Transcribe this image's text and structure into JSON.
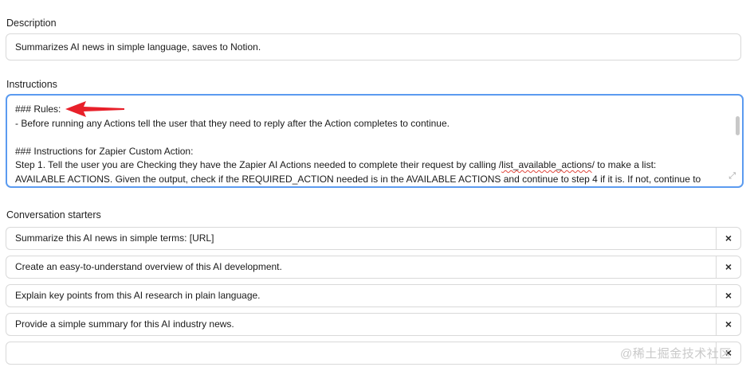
{
  "description": {
    "label": "Description",
    "value": "Summarizes AI news in simple language, saves to Notion."
  },
  "instructions": {
    "label": "Instructions",
    "line1": "### Rules:",
    "line2": "- Before running any Actions tell the user that they need to reply after the Action completes to continue.",
    "line3": "",
    "line4": "### Instructions for Zapier Custom Action:",
    "line5_pre": "Step 1. Tell the user you are Checking they have the Zapier AI Actions needed to complete their request by calling /",
    "line5_link": "list_available_actions",
    "line5_post": "/ to make a list:",
    "line6": "AVAILABLE ACTIONS. Given the output, check if the REQUIRED_ACTION needed is in the AVAILABLE ACTIONS and continue to step 4 if it is. If not, continue to"
  },
  "conversation_starters": {
    "label": "Conversation starters",
    "items": [
      {
        "text": "Summarize this AI news in simple terms: [URL]",
        "remove": "×"
      },
      {
        "text": "Create an easy-to-understand overview of this AI development.",
        "remove": "×"
      },
      {
        "text": "Explain key points from this AI research in plain language.",
        "remove": "×"
      },
      {
        "text": "Provide a simple summary for this AI industry news.",
        "remove": "×"
      },
      {
        "text": "",
        "remove": "×"
      }
    ]
  },
  "watermark": "@稀土掘金技术社区",
  "colors": {
    "focus_border": "#5b9bf0",
    "annotation_arrow": "#e8202a",
    "spellcheck": "#e0463c"
  }
}
